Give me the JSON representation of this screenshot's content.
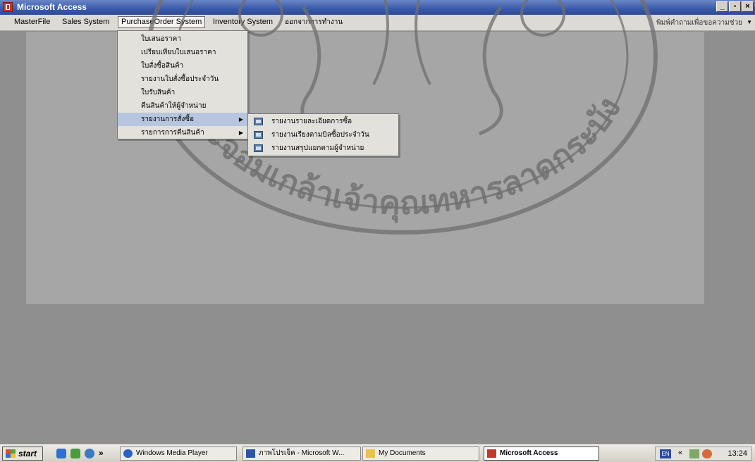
{
  "window": {
    "title": "Microsoft Access"
  },
  "menubar": {
    "items": [
      {
        "label": "MasterFile"
      },
      {
        "label": "Sales System"
      },
      {
        "label": "PurchaseOrder System"
      },
      {
        "label": "Inventory System"
      },
      {
        "label": "ออกจากการทำงาน"
      }
    ],
    "help_box": "พิมพ์คำถามเพื่อขอความช่วย"
  },
  "purchase_menu": {
    "items": [
      {
        "label": "ใบเสนอราคา"
      },
      {
        "label": "เปรียบเทียบใบเสนอราคา"
      },
      {
        "label": "ใบสั่งซื้อสินค้า"
      },
      {
        "label": "รายงานใบสั่งซื้อประจำวัน"
      },
      {
        "label": "ใบรับสินค้า"
      },
      {
        "label": "คืนสินค้าให้ผู้จำหน่าย"
      },
      {
        "label": "รายงานการสั่งซื้อ",
        "submenu": true
      },
      {
        "label": "รายการการคืนสินค้า",
        "submenu": true
      }
    ],
    "highlighted_index": 6
  },
  "report_submenu": {
    "items": [
      {
        "label": "รายงานรายละเอียดการซื้อ"
      },
      {
        "label": "รายงานเรียงตามบิลซื้อประจำวัน"
      },
      {
        "label": "รายงานสรุปแยกตามผู้จำหน่าย"
      }
    ]
  },
  "watermark_text": "พระจอมเกล้าเจ้าคุณทหารลาดกระบัง",
  "taskbar": {
    "start_label": "start",
    "chevron": "»",
    "tasks": [
      {
        "label": "Windows Media Player",
        "icon": "media-player-icon"
      },
      {
        "label": "ภาพโปรเจ็ค - Microsoft W...",
        "icon": "word-icon"
      },
      {
        "label": "My Documents",
        "icon": "folder-icon"
      },
      {
        "label": "Microsoft Access",
        "icon": "access-icon",
        "active": true
      }
    ],
    "tray": {
      "lang": "EN",
      "expand": "«",
      "clock": "13:24"
    }
  },
  "colors": {
    "title_bar": "#3a5aa8",
    "menu_highlight": "#b7c6de",
    "desktop": "#8f8f8f"
  }
}
